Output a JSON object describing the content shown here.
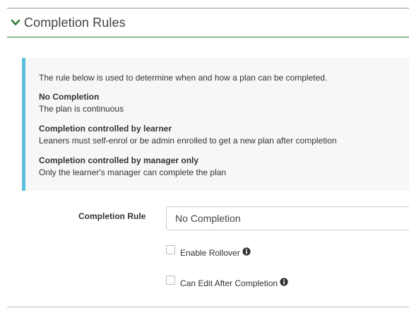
{
  "section": {
    "title": "Completion Rules",
    "accent_color": "#2e7d32",
    "icon": "chevron-down-icon"
  },
  "info_box": {
    "border_color": "#5bc0de",
    "intro": "The rule below is used to determine when and how a plan can be completed.",
    "items": [
      {
        "term": "No Completion",
        "desc": "The plan is continuous"
      },
      {
        "term": "Completion controlled by learner",
        "desc": "Leaners must self-enrol or be admin enrolled to get a new plan after completion"
      },
      {
        "term": "Completion controlled by manager only",
        "desc": "Only the learner's manager can complete the plan"
      }
    ]
  },
  "form": {
    "completion_rule_label": "Completion Rule",
    "completion_rule_value": "No Completion",
    "enable_rollover_label": "Enable Rollover",
    "enable_rollover_checked": false,
    "can_edit_after_label": "Can Edit After Completion",
    "can_edit_after_checked": false,
    "info_icon": "info-circle-icon"
  }
}
